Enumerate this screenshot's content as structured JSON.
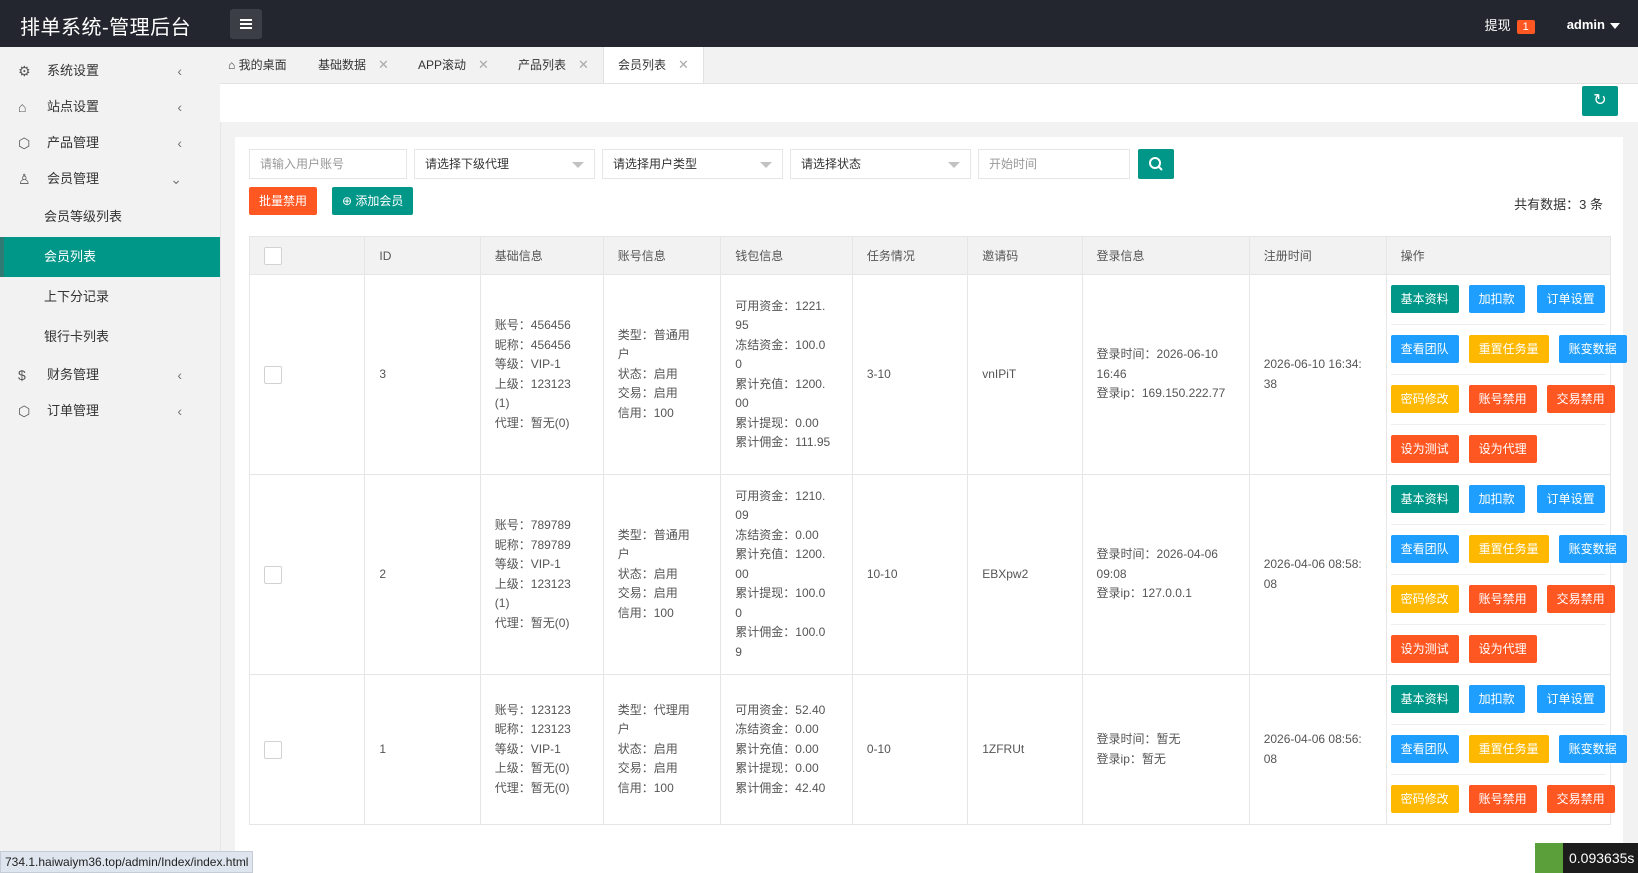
{
  "app": {
    "title": "排单系统-管理后台"
  },
  "header": {
    "withdraw_label": "提现",
    "withdraw_count": "1",
    "user": "admin"
  },
  "sidebar": {
    "items": [
      {
        "label": "系统设置",
        "icon": "gear-icon"
      },
      {
        "label": "站点设置",
        "icon": "site-icon"
      },
      {
        "label": "产品管理",
        "icon": "cube-icon"
      },
      {
        "label": "会员管理",
        "icon": "user-icon"
      }
    ],
    "sub_items": [
      {
        "label": "会员等级列表"
      },
      {
        "label": "会员列表"
      },
      {
        "label": "上下分记录"
      },
      {
        "label": "银行卡列表"
      }
    ],
    "tail_items": [
      {
        "label": "财务管理",
        "icon": "dollar-icon"
      },
      {
        "label": "订单管理",
        "icon": "box-icon"
      }
    ]
  },
  "tabs": [
    {
      "label": "我的桌面"
    },
    {
      "label": "基础数据"
    },
    {
      "label": "APP滚动"
    },
    {
      "label": "产品列表"
    },
    {
      "label": "会员列表"
    }
  ],
  "filters": {
    "account_placeholder": "请输入用户账号",
    "agent_select": "请选择下级代理",
    "type_select": "请选择用户类型",
    "status_select": "请选择状态",
    "start_time_placeholder": "开始时间"
  },
  "actions": {
    "batch_disable": "批量禁用",
    "add_member": "添加会员",
    "total": "共有数据：3 条"
  },
  "table": {
    "headers": [
      "ID",
      "基础信息",
      "账号信息",
      "钱包信息",
      "任务情况",
      "邀请码",
      "登录信息",
      "注册时间",
      "操作"
    ],
    "op_labels": {
      "basic": "基本资料",
      "balance": "加扣款",
      "order": "订单设置",
      "team": "查看团队",
      "reset": "重置任务量",
      "ledger": "账变数据",
      "pwd": "密码修改",
      "ban_account": "账号禁用",
      "ban_trade": "交易禁用",
      "set_test": "设为测试",
      "set_agent": "设为代理"
    },
    "rows": [
      {
        "id": "3",
        "basic": [
          "账号：456456",
          "昵称：456456",
          "等级：VIP-1",
          "上级：123123",
          "(1)",
          "代理：暂无(0)"
        ],
        "account": [
          "类型：普通用",
          "户",
          "状态：启用",
          "交易：启用",
          "信用：100"
        ],
        "wallet": [
          "可用资金：1221.",
          "95",
          "冻结资金：100.0",
          "0",
          "累计充值：1200.",
          "00",
          "累计提现：0.00",
          "累计佣金：111.95"
        ],
        "task": "3-10",
        "invite": "vnIPiT",
        "login": [
          "登录时间：2026-06-10",
          "16:46",
          "登录ip：169.150.222.77"
        ],
        "reg": [
          "2026-06-10 16:34:",
          "38"
        ]
      },
      {
        "id": "2",
        "basic": [
          "账号：789789",
          "昵称：789789",
          "等级：VIP-1",
          "上级：123123",
          "(1)",
          "代理：暂无(0)"
        ],
        "account": [
          "类型：普通用",
          "户",
          "状态：启用",
          "交易：启用",
          "信用：100"
        ],
        "wallet": [
          "可用资金：1210.",
          "09",
          "冻结资金：0.00",
          "累计充值：1200.",
          "00",
          "累计提现：100.0",
          "0",
          "累计佣金：100.0",
          "9"
        ],
        "task": "10-10",
        "invite": "EBXpw2",
        "login": [
          "登录时间：2026-04-06",
          "09:08",
          "登录ip：127.0.0.1"
        ],
        "reg": [
          "2026-04-06 08:58:",
          "08"
        ]
      },
      {
        "id": "1",
        "basic": [
          "账号：123123",
          "昵称：123123",
          "等级：VIP-1",
          "上级：暂无(0)",
          "代理：暂无(0)"
        ],
        "account": [
          "类型：代理用",
          "户",
          "状态：启用",
          "交易：启用",
          "信用：100"
        ],
        "wallet": [
          "可用资金：52.40",
          "冻结资金：0.00",
          "累计充值：0.00",
          "累计提现：0.00",
          "累计佣金：42.40"
        ],
        "task": "0-10",
        "invite": "1ZFRUt",
        "login": [
          "登录时间：暂无",
          "登录ip：暂无"
        ],
        "reg": [
          "2026-04-06 08:56:",
          "08"
        ]
      }
    ]
  },
  "status_url": "734.1.haiwaiym36.top/admin/Index/index.html",
  "timer": "0.093635s"
}
